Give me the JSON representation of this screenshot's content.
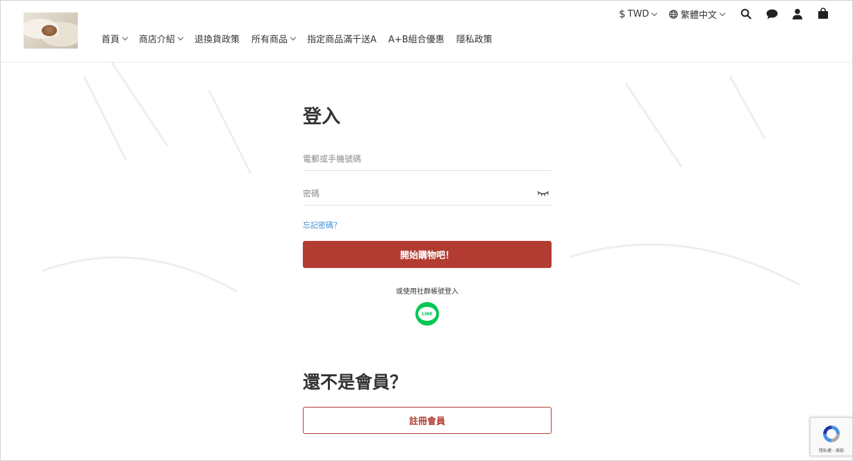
{
  "header": {
    "nav": [
      {
        "label": "首頁",
        "has_dropdown": true
      },
      {
        "label": "商店介紹",
        "has_dropdown": true
      },
      {
        "label": "退換貨政策",
        "has_dropdown": false
      },
      {
        "label": "所有商品",
        "has_dropdown": true
      },
      {
        "label": "指定商品滿千送A",
        "has_dropdown": false
      },
      {
        "label": "A+B組合優惠",
        "has_dropdown": false
      },
      {
        "label": "隱私政策",
        "has_dropdown": false
      }
    ],
    "currency": {
      "symbol": "$",
      "label": "TWD"
    },
    "language": {
      "label": "繁體中文"
    },
    "icons": [
      "search-icon",
      "chat-icon",
      "user-icon",
      "cart-icon"
    ]
  },
  "login": {
    "title": "登入",
    "email_placeholder": "電郵或手機號碼",
    "email_value": "",
    "password_placeholder": "密碼",
    "password_value": "",
    "forgot_label": "忘記密碼？",
    "submit_label": "開始購物吧！",
    "social_label": "或使用社群帳號登入",
    "line_label": "LINE"
  },
  "register": {
    "title": "還不是會員？",
    "button_label": "註冊會員"
  },
  "recaptcha": {
    "footer": "隱私權 - 條款"
  },
  "colors": {
    "brand_red": "#b23c31",
    "link_blue": "#3a8dd6",
    "line_green": "#06c755"
  }
}
